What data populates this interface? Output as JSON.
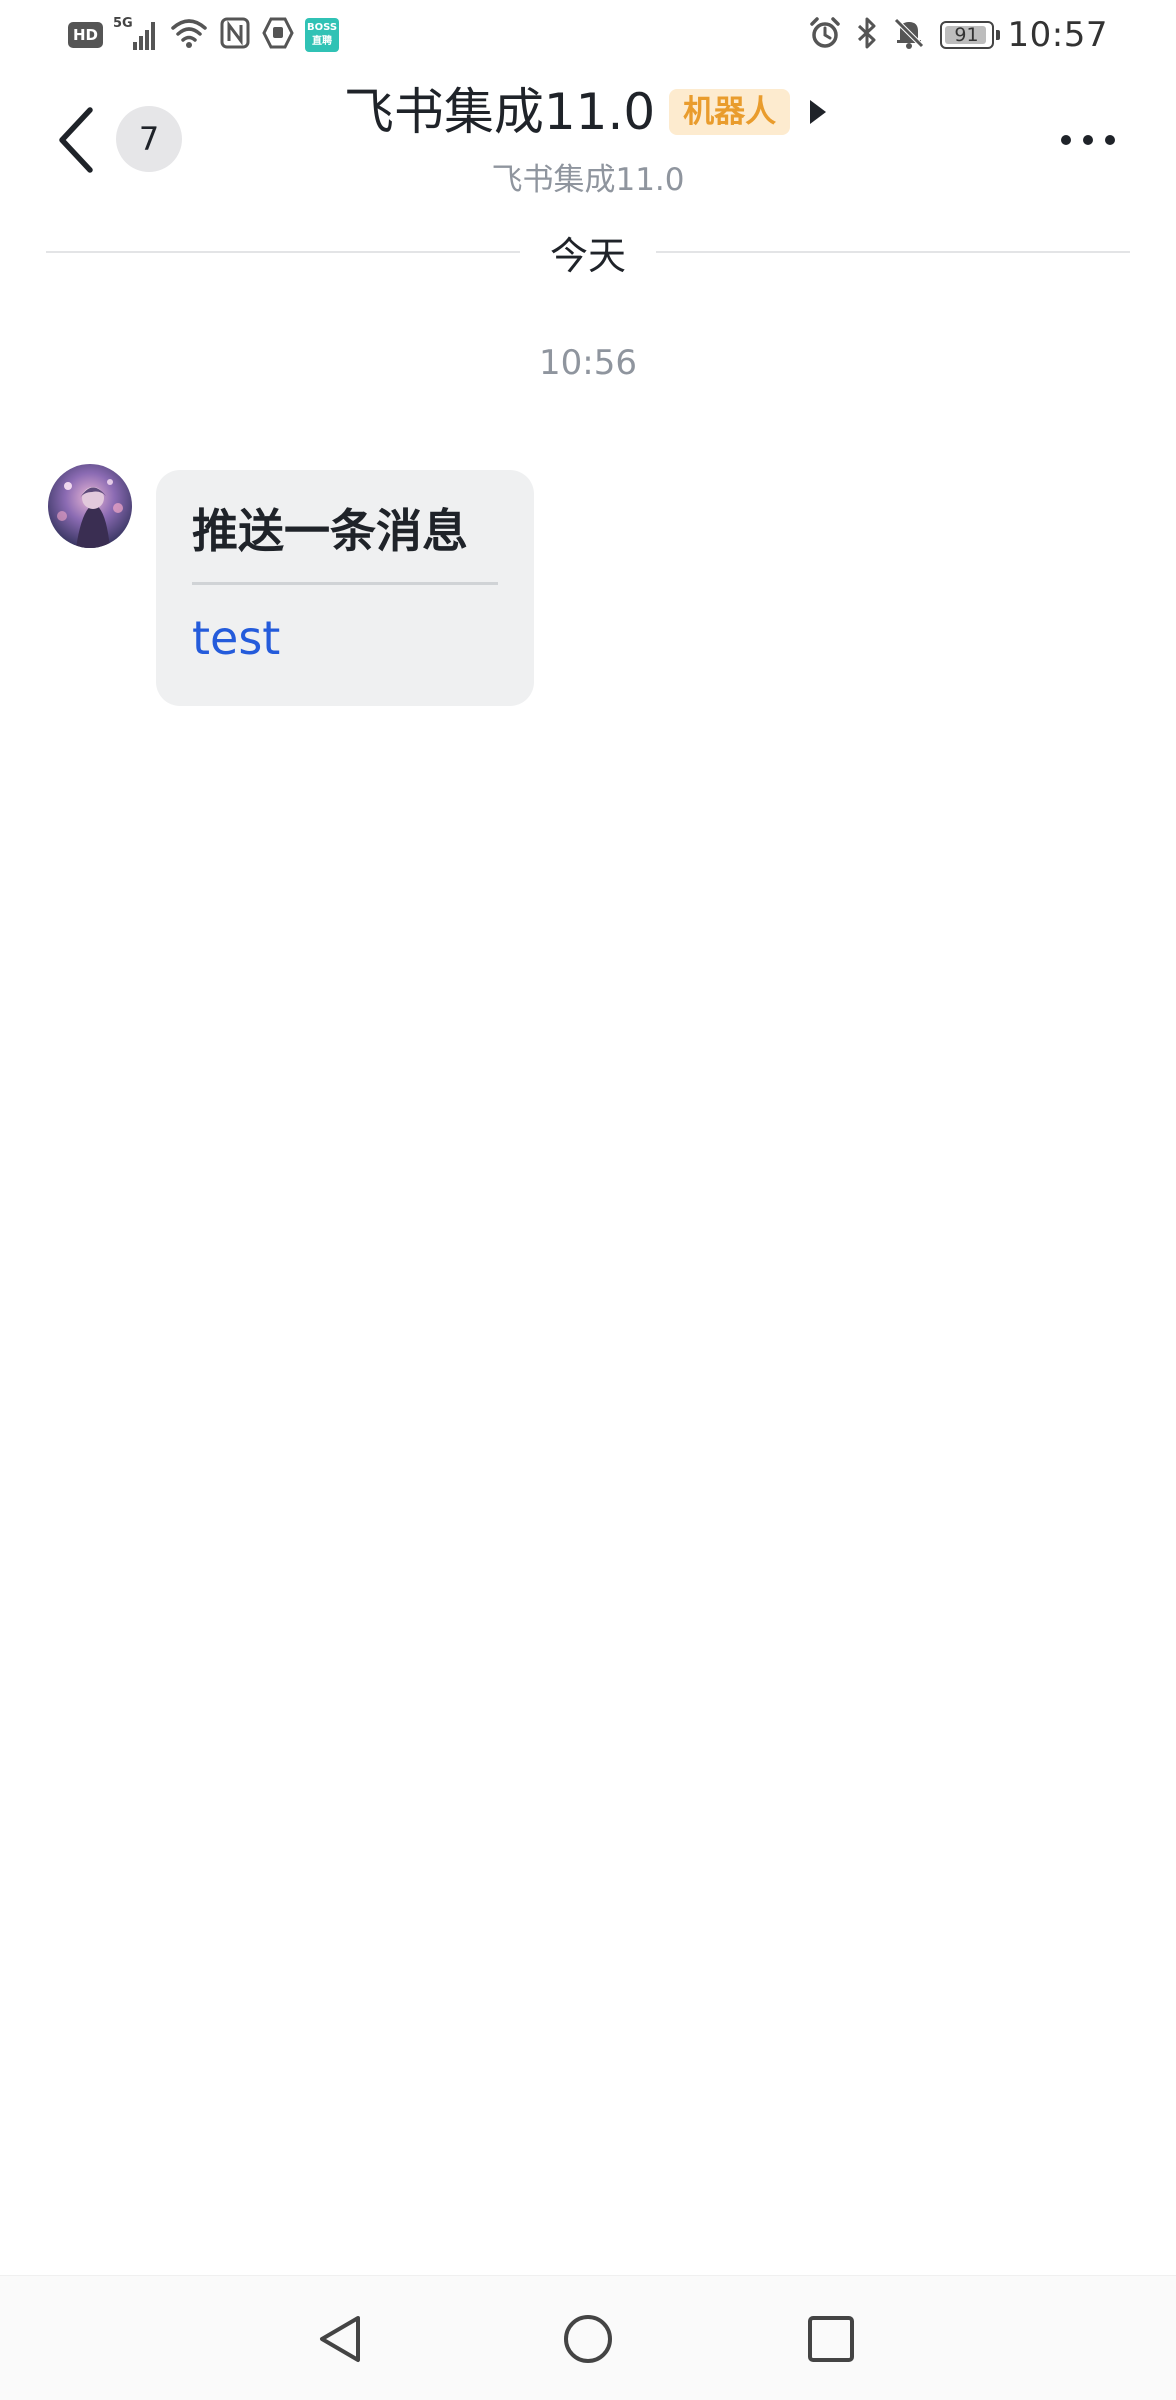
{
  "status_bar": {
    "hd_label": "HD",
    "network_label": "5G",
    "boss_app_label": "BOSS",
    "boss_app_sublabel": "直聘",
    "battery_level": "91",
    "time": "10:57"
  },
  "header": {
    "unread_count": "7",
    "title": "飞书集成11.0",
    "bot_tag": "机器人",
    "subtitle": "飞书集成11.0"
  },
  "chat": {
    "date_divider": "今天",
    "message_time": "10:56",
    "message": {
      "card_title": "推送一条消息",
      "card_body": "test"
    }
  },
  "colors": {
    "bot_tag_bg": "#fdebcf",
    "bot_tag_text": "#e99c2d",
    "link_blue": "#245bdb",
    "card_bg": "#eff0f1"
  }
}
